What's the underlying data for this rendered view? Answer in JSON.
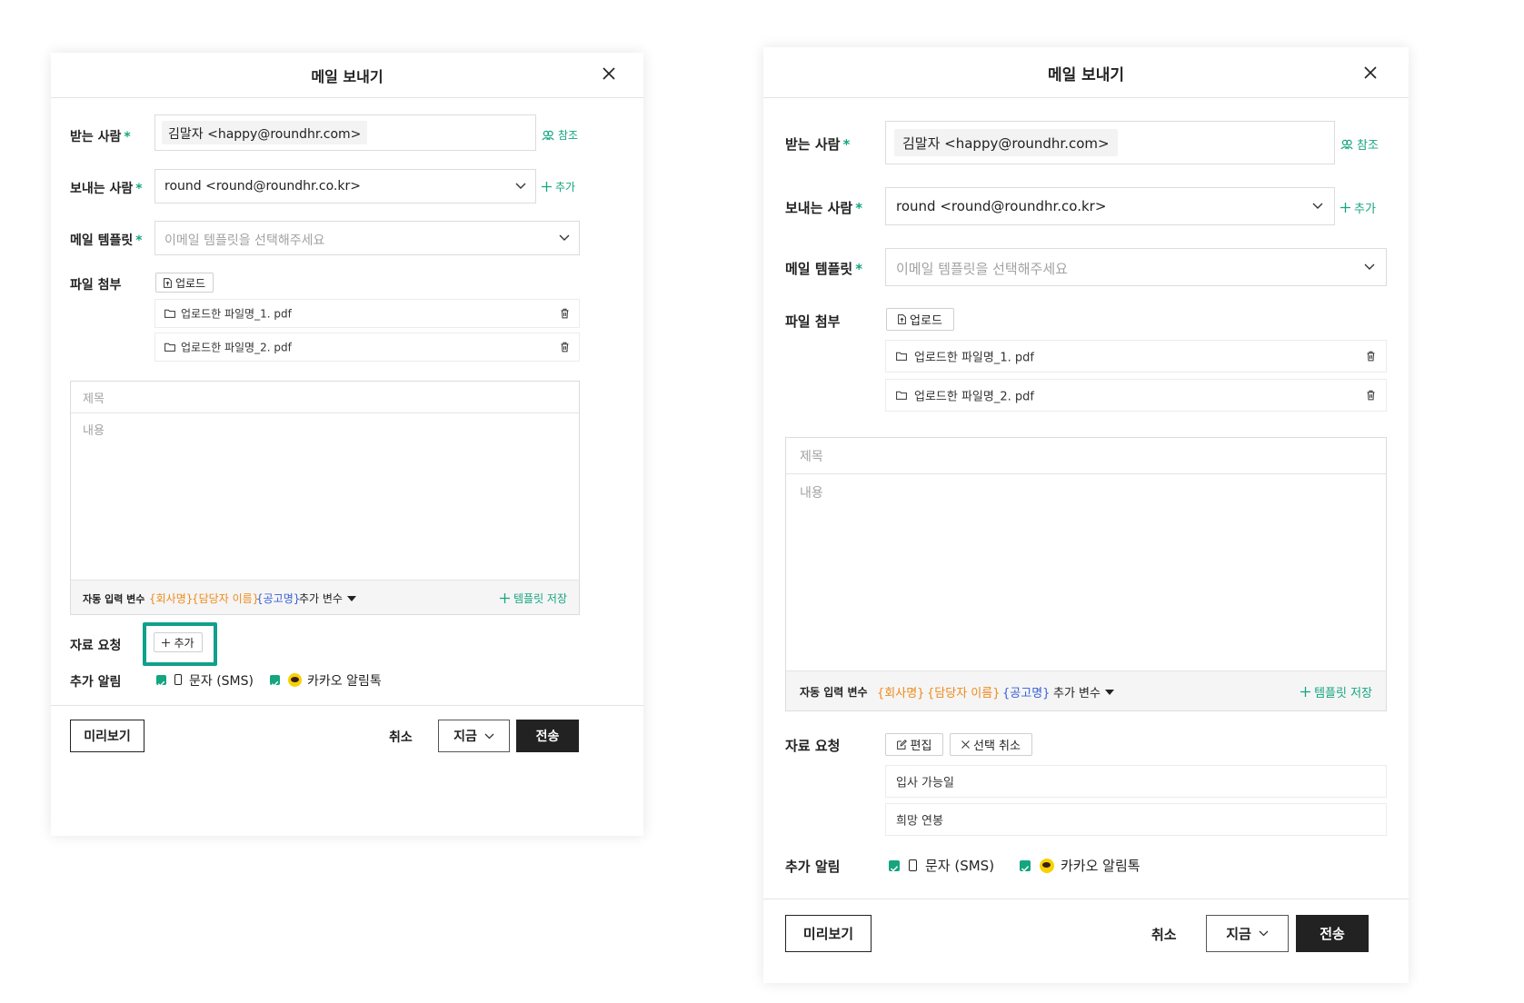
{
  "left_dialog": {
    "title": "메일 보내기",
    "recipient": {
      "label": "받는 사람",
      "chip": "김말자 <happy@roundhr.com>",
      "cc_link": "참조"
    },
    "sender": {
      "label": "보내는 사람",
      "value": "round <round@roundhr.co.kr>",
      "add_link": "추가"
    },
    "template": {
      "label": "메일 템플릿",
      "placeholder": "이메일 템플릿을 선택해주세요"
    },
    "attachment": {
      "label": "파일 첨부",
      "upload_label": "업로드",
      "files": [
        "업로드한 파일명_1. pdf",
        "업로드한 파일명_2. pdf"
      ]
    },
    "editor": {
      "subject_placeholder": "제목",
      "body_placeholder": "내용",
      "vars_label": "자동 입력 변수",
      "var_company": "{회사명}",
      "var_manager": "{담당자 이름}",
      "var_posting": "{공고명}",
      "add_var_label": "추가 변수",
      "save_template_label": "템플릿 저장"
    },
    "request": {
      "label": "자료 요청",
      "add_label": "추가"
    },
    "notify": {
      "label": "추가 알림",
      "sms_label": "문자 (SMS)",
      "kakao_label": "카카오 알림톡"
    },
    "footer": {
      "preview_label": "미리보기",
      "cancel_label": "취소",
      "timing_label": "지금",
      "send_label": "전송"
    }
  },
  "right_dialog": {
    "title": "메일 보내기",
    "recipient": {
      "label": "받는 사람",
      "chip": "김말자 <happy@roundhr.com>",
      "cc_link": "참조"
    },
    "sender": {
      "label": "보내는 사람",
      "value": "round <round@roundhr.co.kr>",
      "add_link": "추가"
    },
    "template": {
      "label": "메일 템플릿",
      "placeholder": "이메일 템플릿을 선택해주세요"
    },
    "attachment": {
      "label": "파일 첨부",
      "upload_label": "업로드",
      "files": [
        "업로드한 파일명_1. pdf",
        "업로드한 파일명_2. pdf"
      ]
    },
    "editor": {
      "subject_placeholder": "제목",
      "body_placeholder": "내용",
      "vars_label": "자동 입력 변수",
      "var_company": "{회사명}",
      "var_manager": "{담당자 이름}",
      "var_posting": "{공고명}",
      "add_var_label": "추가 변수",
      "save_template_label": "템플릿 저장"
    },
    "request": {
      "label": "자료 요청",
      "edit_label": "편집",
      "deselect_label": "선택 취소",
      "items": [
        "입사 가능일",
        "희망 연봉"
      ]
    },
    "notify": {
      "label": "추가 알림",
      "sms_label": "문자 (SMS)",
      "kakao_label": "카카오 알림톡"
    },
    "footer": {
      "preview_label": "미리보기",
      "cancel_label": "취소",
      "timing_label": "지금",
      "send_label": "전송"
    }
  },
  "colors": {
    "accent_green": "#15a57f",
    "highlight_teal": "#10a08c",
    "var_orange": "#f08a1a",
    "var_blue": "#3760d8",
    "dark_button": "#222222"
  }
}
